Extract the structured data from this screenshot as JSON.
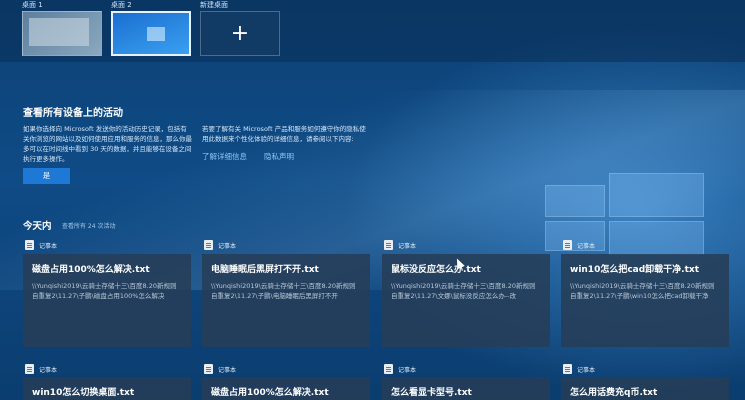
{
  "desktops": [
    {
      "label": "桌面 1"
    },
    {
      "label": "桌面 2"
    },
    {
      "label": "新建桌面",
      "icon": "plus-icon"
    }
  ],
  "promo": {
    "title": "查看所有设备上的活动",
    "text1": "如果你选择向 Microsoft 发送你的活动历史记录，包括有关你浏览的网站以及如何使用应用和服务的信息，那么你最多可以在时间线中看到 30 天的数据，并且能够在设备之间执行更多操作。",
    "text2": "若要了解有关 Microsoft 产品和服务如何遵守你的隐私使用此数据来个性化体验的详细信息，请参阅以下内容:",
    "link1": "了解详细信息",
    "link2": "隐私声明",
    "yes_label": "是"
  },
  "today": {
    "title": "今天内",
    "subtitle": "查看所有 24 次活动"
  },
  "cards": [
    {
      "app": "记事本",
      "title": "磁盘占用100%怎么解决.txt",
      "path": "\\\\Yunqishi2019\\云骑士存储十三\\百度8.20新规则自重复2\\11.27\\子鹏\\磁盘占用100%怎么解决"
    },
    {
      "app": "记事本",
      "title": "电脑睡眠后黑屏打不开.txt",
      "path": "\\\\Yunqishi2019\\云骑士存储十三\\百度8.20新规则自重复2\\11.27\\子鹏\\电脑睡眠后黑屏打不开"
    },
    {
      "app": "记事本",
      "title": "鼠标没反应怎么办.txt",
      "path": "\\\\Yunqishi2019\\云骑士存储十三\\百度8.20新规则自重复2\\11.27\\文娜\\鼠标没反应怎么办--改"
    },
    {
      "app": "记事本",
      "title": "win10怎么把cad卸载干净.txt",
      "path": "\\\\Yunqishi2019\\云骑士存储十三\\百度8.20新规则自重复2\\11.27\\子鹏\\win10怎么把cad卸载干净"
    },
    {
      "app": "记事本",
      "title": "win10怎么切换桌面.txt",
      "path": ""
    },
    {
      "app": "记事本",
      "title": "磁盘占用100%怎么解决.txt",
      "path": ""
    },
    {
      "app": "记事本",
      "title": "怎么看显卡型号.txt",
      "path": ""
    },
    {
      "app": "记事本",
      "title": "怎么用话费充q币.txt",
      "path": ""
    }
  ]
}
